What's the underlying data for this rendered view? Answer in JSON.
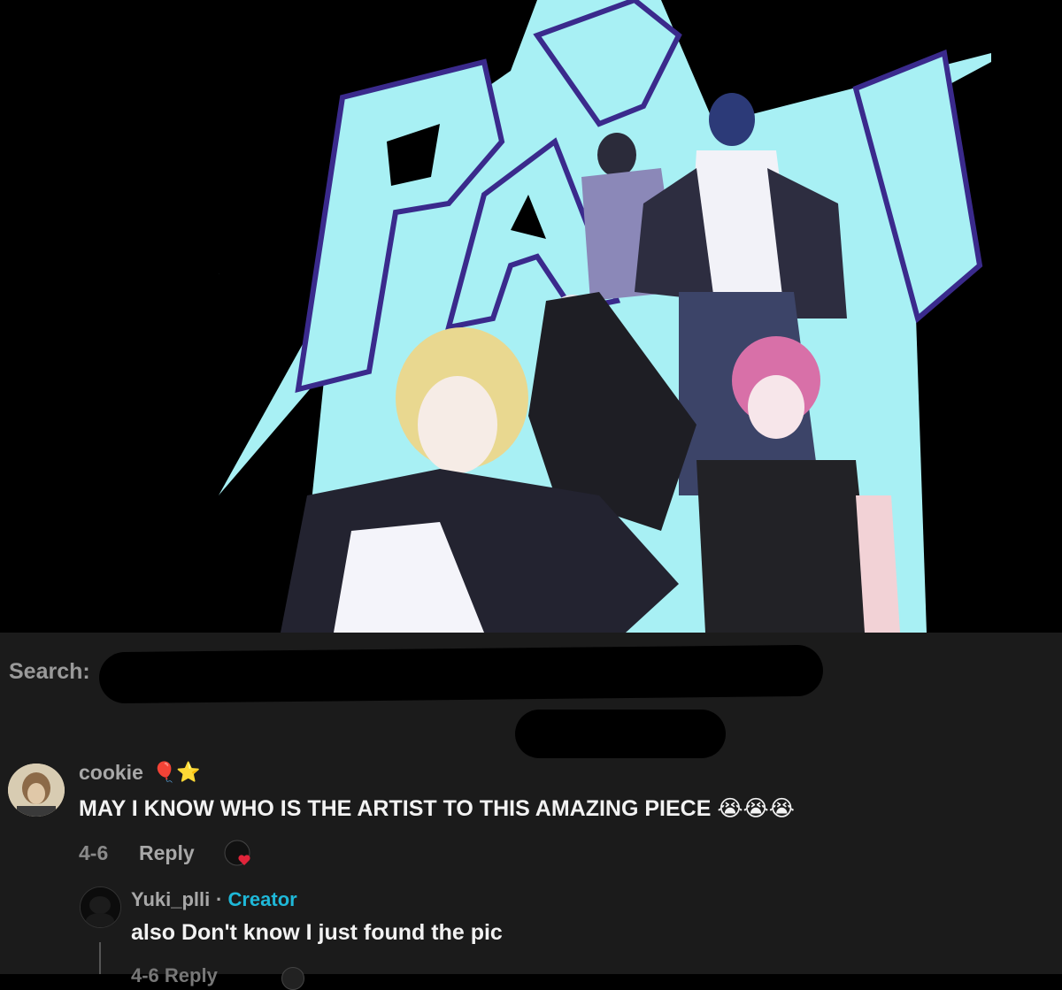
{
  "search": {
    "label": "Search:"
  },
  "comments": [
    {
      "username": "cookie",
      "badges": "🎈⭐",
      "text": "MAY I KNOW WHO IS THE ARTIST TO THIS AMAZING PIECE 😭😭😭",
      "date": "4-6",
      "reply_label": "Reply"
    },
    {
      "username": "Yuki_plli",
      "separator": "·",
      "role": "Creator",
      "text": "also Don't know I just found the pic",
      "partial_meta": "4-6   Reply"
    }
  ],
  "colors": {
    "comment_bg": "#1b1b1b",
    "creator_accent": "#1fb8d8",
    "artwork_bg": "#a8f0f4",
    "heart": "#e0243a"
  }
}
